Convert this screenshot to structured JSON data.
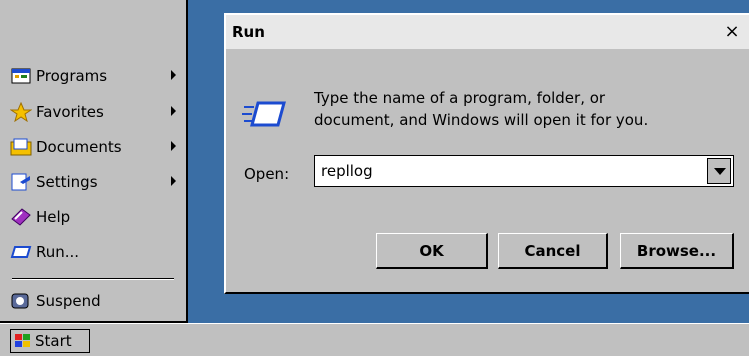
{
  "start_menu": {
    "items": [
      {
        "label": "Programs",
        "mnemonic": "P",
        "icon": "programs-icon",
        "submenu": true
      },
      {
        "label": "Favorites",
        "mnemonic": "a",
        "icon": "favorites-star-icon",
        "submenu": true
      },
      {
        "label": "Documents",
        "mnemonic": "D",
        "icon": "documents-icon",
        "submenu": true
      },
      {
        "label": "Settings",
        "mnemonic": "S",
        "icon": "settings-icon",
        "submenu": true
      },
      {
        "label": "Help",
        "mnemonic": "H",
        "icon": "help-book-icon",
        "submenu": false
      },
      {
        "label": "Run...",
        "mnemonic": "R",
        "icon": "run-icon",
        "submenu": false
      },
      {
        "label": "Suspend",
        "mnemonic": "u",
        "icon": "suspend-icon",
        "submenu": false
      }
    ]
  },
  "taskbar": {
    "start_label": "Start"
  },
  "run_dialog": {
    "title": "Run",
    "close_label": "×",
    "prompt_line1": "Type the name of a program, folder, or",
    "prompt_line2": "document, and Windows will open it for you.",
    "open_label": "Open:",
    "open_value": "repllog",
    "ok_label": "OK",
    "cancel_label": "Cancel",
    "browse_label": "Browse..."
  },
  "colors": {
    "desktop": "#3a6ea5",
    "face": "#c0c0c0"
  }
}
